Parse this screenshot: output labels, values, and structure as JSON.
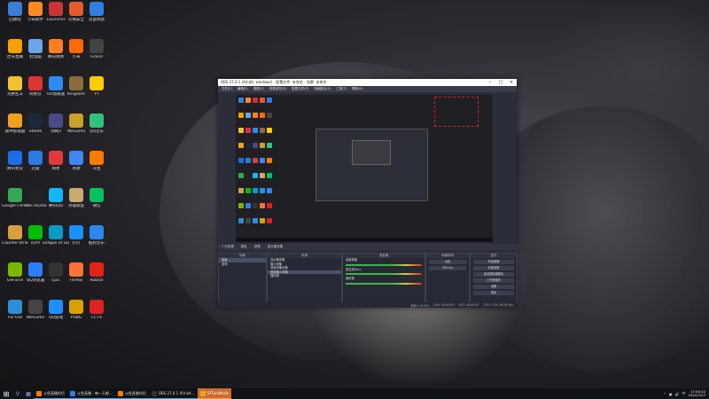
{
  "desktop": {
    "icons": [
      {
        "label": "回收站",
        "color": "#3c7dd9"
      },
      {
        "label": "小米助手",
        "color": "#ff8a24"
      },
      {
        "label": "Launcher",
        "color": "#c33"
      },
      {
        "label": "火绒安全",
        "color": "#e55b2a"
      },
      {
        "label": "百度网盘",
        "color": "#2f7fe0"
      },
      {
        "label": "虎牙直播",
        "color": "#f5a100"
      },
      {
        "label": "此电脑",
        "color": "#6aa6e8"
      },
      {
        "label": "腾讯视频",
        "color": "#ff7f1f"
      },
      {
        "label": "小米",
        "color": "#ff6900"
      },
      {
        "label": "Grand",
        "color": "#444"
      },
      {
        "label": "荒野乱斗",
        "color": "#f2c230"
      },
      {
        "label": "网易云",
        "color": "#d33"
      },
      {
        "label": "UU加速器",
        "color": "#2b8cf2"
      },
      {
        "label": "Kingdom",
        "color": "#8a6d3b"
      },
      {
        "label": "YY",
        "color": "#ffcc00"
      },
      {
        "label": "雷神加速器",
        "color": "#f2a020"
      },
      {
        "label": "Steam",
        "color": "#1b2838"
      },
      {
        "label": "剑网3",
        "color": "#4a4a8a"
      },
      {
        "label": "WeGame",
        "color": "#c9a227"
      },
      {
        "label": "QQ音乐",
        "color": "#31c27c"
      },
      {
        "label": "腾讯会议",
        "color": "#1d6ce8"
      },
      {
        "label": "迅雷",
        "color": "#2a7be0"
      },
      {
        "label": "网易",
        "color": "#e03a3a"
      },
      {
        "label": "谷歌",
        "color": "#4285f4"
      },
      {
        "label": "斗鱼",
        "color": "#ff7a00"
      },
      {
        "label": "Google Chrome",
        "color": "#34a853"
      },
      {
        "label": "OBS Studio",
        "color": "#222"
      },
      {
        "label": "腾讯QQ",
        "color": "#12b7f5"
      },
      {
        "label": "英雄联盟",
        "color": "#c8aa6e"
      },
      {
        "label": "微信",
        "color": "#07c160"
      },
      {
        "label": "Counter-Strike",
        "color": "#d8a03a"
      },
      {
        "label": "iQIYI",
        "color": "#00be06"
      },
      {
        "label": "League of Legends",
        "color": "#0a9ac8"
      },
      {
        "label": "钉钉",
        "color": "#1890ff"
      },
      {
        "label": "酷狗音乐",
        "color": "#2a88f0"
      },
      {
        "label": "GeForce",
        "color": "#76b900"
      },
      {
        "label": "QQ浏览器",
        "color": "#2b7ef5"
      },
      {
        "label": "Epic",
        "color": "#333"
      },
      {
        "label": "Firefox",
        "color": "#ff7139"
      },
      {
        "label": "Roblox",
        "color": "#e2231a"
      },
      {
        "label": "Far Out",
        "color": "#2c8fd6"
      },
      {
        "label": "WeGame",
        "color": "#444"
      },
      {
        "label": "QQ游戏",
        "color": "#1e90ff"
      },
      {
        "label": "PUBG",
        "color": "#d8a300"
      },
      {
        "label": "CCTV",
        "color": "#d22"
      }
    ]
  },
  "obs": {
    "title": "OBS 27.0.1 (64-bit, windows) - 配置文件: 未命名 - 场景: 未命名",
    "menu": [
      "文件(F)",
      "编辑(E)",
      "视图(V)",
      "停靠部件(D)",
      "配置文件(P)",
      "场景集合(S)",
      "工具(T)",
      "帮助(H)"
    ],
    "scene_toolbar": [
      "属性",
      "滤镜",
      "显示器采集"
    ],
    "docks": {
      "scenes": {
        "title": "场景",
        "items": [
          "场景",
          "游戏"
        ]
      },
      "sources": {
        "title": "来源",
        "items": [
          "显示器采集",
          "窗口采集",
          "视频采集设备",
          "音频输入采集",
          "媒体源"
        ]
      },
      "mixer": {
        "title": "混音器",
        "channels": [
          {
            "name": "桌面音频",
            "db": "0.0 dB"
          },
          {
            "name": "麦克风/Aux",
            "db": "0.0 dB"
          },
          {
            "name": "媒体源",
            "db": "0.0 dB"
          }
        ]
      },
      "transitions": {
        "title": "场景转场",
        "mode": "淡出",
        "duration": "300 ms"
      },
      "controls": {
        "title": "控件",
        "buttons": [
          "开始直播",
          "开始录制",
          "启动虚拟摄像机",
          "工作室模式",
          "设置",
          "退出"
        ]
      }
    },
    "status": {
      "dropped": "丢帧 0 (0.0%)",
      "live": "LIVE: 00:00:00",
      "rec": "REC: 00:00:00",
      "cpu": "CPU: 1.5%, 60.00 fps"
    }
  },
  "taskbar": {
    "apps": [
      {
        "label": "斗鱼直播伴侣",
        "color": "#ff7a00",
        "active": false
      },
      {
        "label": "斗鱼直播 - 每一天都...",
        "color": "#2b7ef5",
        "active": false
      },
      {
        "label": "斗鱼直播伴侣",
        "color": "#ff7a00",
        "active": false
      },
      {
        "label": "OBS 27.0.1 (64-bit...",
        "color": "#333",
        "active": false
      },
      {
        "label": "SYTurnMode",
        "color": "#f2a020",
        "active": true
      }
    ],
    "time": "17:00:42",
    "date": "2022/7/27"
  }
}
